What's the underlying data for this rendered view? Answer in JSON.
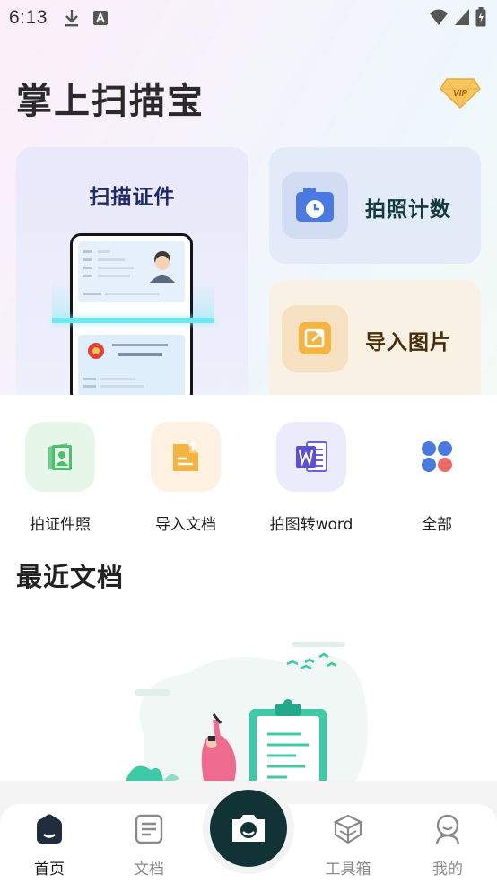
{
  "status_bar": {
    "time": "6:13",
    "icons": [
      "download-icon",
      "a-icon",
      "wifi-icon",
      "signal-icon",
      "battery-icon"
    ]
  },
  "app": {
    "title": "掌上扫描宝",
    "vip_label": "VIP"
  },
  "feature_cards": {
    "scan_id": {
      "label": "扫描证件",
      "icon": "id-card-scan-illustration"
    },
    "photo_count": {
      "label": "拍照计数",
      "icon": "camera-clock-icon",
      "accent": "#4a7ae0"
    },
    "import_image": {
      "label": "导入图片",
      "icon": "image-import-icon",
      "accent": "#f2a33a"
    }
  },
  "tools": [
    {
      "label": "拍证件照",
      "icon": "id-photo-icon",
      "bg": "#e6f7ea",
      "color": "#4bbf6b"
    },
    {
      "label": "导入文档",
      "icon": "import-doc-icon",
      "bg": "#fdf1e1",
      "color": "#f2a33a"
    },
    {
      "label": "拍图转word",
      "icon": "word-icon",
      "bg": "#ecebfb",
      "color": "#5b4fd6"
    },
    {
      "label": "全部",
      "icon": "all-apps-icon",
      "bg": "#ffffff",
      "color": "#4a7ae0"
    }
  ],
  "recent": {
    "title": "最近文档",
    "illustration": "empty-documents-illustration"
  },
  "bottom_nav": {
    "items": [
      {
        "label": "首页",
        "icon": "home-icon",
        "active": true
      },
      {
        "label": "文档",
        "icon": "document-icon",
        "active": false
      },
      {
        "label": "工具箱",
        "icon": "toolbox-icon",
        "active": false
      },
      {
        "label": "我的",
        "icon": "profile-icon",
        "active": false
      }
    ],
    "center_action": "camera-icon"
  },
  "colors": {
    "title": "#2a2a2a",
    "nav_active": "#1a1a1a",
    "nav_inactive": "#8a8a8a",
    "camera_button": "#123336"
  }
}
